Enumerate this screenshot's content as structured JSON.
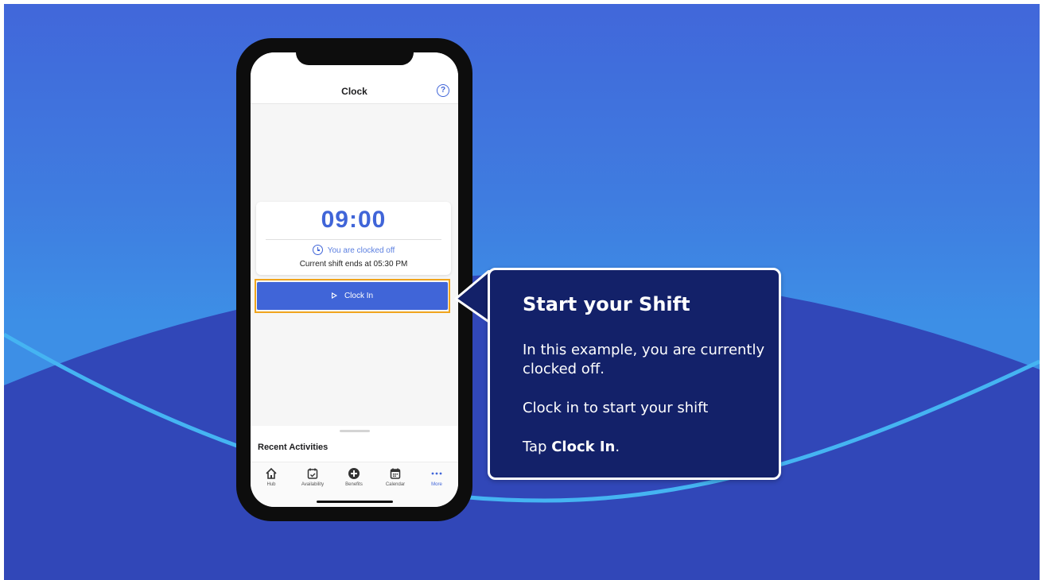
{
  "app": {
    "title": "Clock",
    "help_label": "?"
  },
  "clock": {
    "time": "09:00",
    "status": "You are clocked off",
    "shift_ends": "Current shift ends at 05:30 PM",
    "clock_in_label": "Clock In"
  },
  "recent": {
    "title": "Recent Activities"
  },
  "tabs": [
    {
      "label": "Hub",
      "icon": "home-icon"
    },
    {
      "label": "Availability",
      "icon": "calendar-check-icon"
    },
    {
      "label": "Benefits",
      "icon": "plus-circle-icon"
    },
    {
      "label": "Calendar",
      "icon": "calendar-icon"
    },
    {
      "label": "More",
      "icon": "more-icon"
    }
  ],
  "callout": {
    "title": "Start your Shift",
    "text1": "In this example, you are currently clocked off.",
    "text2": "Clock in to start your shift",
    "text3_prefix": "Tap ",
    "text3_bold": "Clock In",
    "text3_suffix": "."
  },
  "colors": {
    "accent": "#4065d8",
    "highlight": "#f0a51e",
    "callout_bg": "#132169"
  }
}
